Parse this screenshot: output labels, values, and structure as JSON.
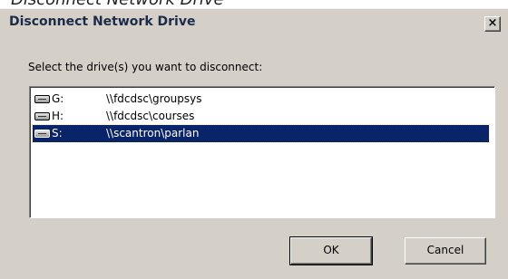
{
  "caption": "Disconnect Network Drive",
  "window": {
    "title": "Disconnect Network Drive",
    "close_glyph": "×"
  },
  "prompt": "Select the drive(s) you want to disconnect:",
  "drives": [
    {
      "letter": "G:",
      "path": "\\\\fdcdsc\\groupsys",
      "icon": "network-drive-icon",
      "selected": false
    },
    {
      "letter": "H:",
      "path": "\\\\fdcdsc\\courses",
      "icon": "network-drive-icon",
      "selected": false
    },
    {
      "letter": "S:",
      "path": "\\\\scantron\\parlan",
      "icon": "network-drive-icon",
      "selected": true
    }
  ],
  "buttons": {
    "ok": "OK",
    "cancel": "Cancel"
  },
  "colors": {
    "dialog_face": "#d4d0c8",
    "selection": "#0a246a"
  }
}
